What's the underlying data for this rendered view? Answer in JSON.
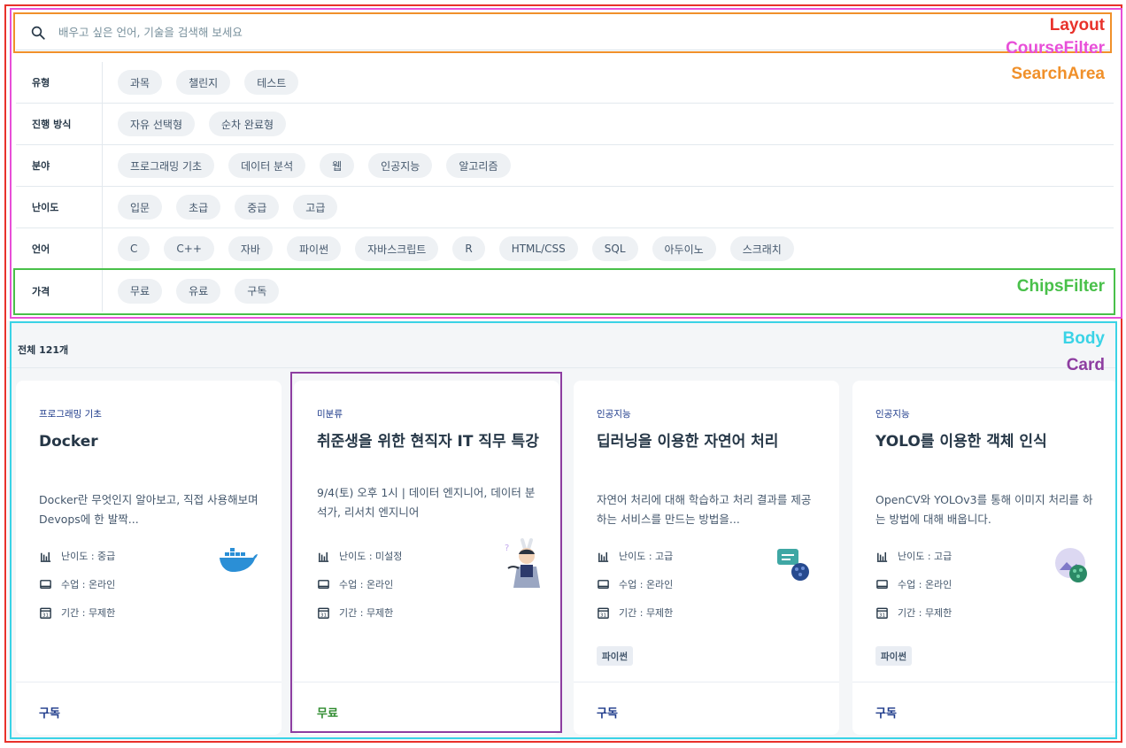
{
  "search": {
    "placeholder": "배우고 싶은 언어, 기술을 검색해 보세요"
  },
  "filters": [
    {
      "label": "유형",
      "chips": [
        "과목",
        "챌린지",
        "테스트"
      ]
    },
    {
      "label": "진행 방식",
      "chips": [
        "자유 선택형",
        "순차 완료형"
      ]
    },
    {
      "label": "분야",
      "chips": [
        "프로그래밍 기초",
        "데이터 분석",
        "웹",
        "인공지능",
        "알고리즘"
      ]
    },
    {
      "label": "난이도",
      "chips": [
        "입문",
        "초급",
        "중급",
        "고급"
      ]
    },
    {
      "label": "언어",
      "chips": [
        "C",
        "C++",
        "자바",
        "파이썬",
        "자바스크립트",
        "R",
        "HTML/CSS",
        "SQL",
        "아두이노",
        "스크래치"
      ]
    },
    {
      "label": "가격",
      "chips": [
        "무료",
        "유료",
        "구독"
      ]
    }
  ],
  "body": {
    "total": "전체 121개"
  },
  "cards": [
    {
      "category": "프로그래밍 기초",
      "title": "Docker",
      "desc": "Docker란 무엇인지 알아보고, 직접 사용해보며 Devops에 한 발짝...",
      "difficulty": "난이도 : 중급",
      "mode": "수업 : 온라인",
      "period": "기간 : 무제한",
      "tag": "",
      "price": "구독",
      "price_color": "#1d3a8a",
      "icon": "docker-whale-icon"
    },
    {
      "category": "미분류",
      "title": "취준생을 위한 현직자 IT 직무 특강",
      "desc": "9/4(토) 오후 1시 | 데이터 엔지니어, 데이터 분석가, 리서치 엔지니어",
      "difficulty": "난이도 : 미설정",
      "mode": "수업 : 온라인",
      "period": "기간 : 무제한",
      "tag": "",
      "price": "무료",
      "price_color": "#2e8b2e",
      "icon": "rabbit-character-icon"
    },
    {
      "category": "인공지능",
      "title": "딥러닝을 이용한 자연어 처리",
      "desc": "자연어 처리에 대해 학습하고 처리 결과를 제공하는 서비스를 만드는 방법을...",
      "difficulty": "난이도 : 고급",
      "mode": "수업 : 온라인",
      "period": "기간 : 무제한",
      "tag": "파이썬",
      "price": "구독",
      "price_color": "#1d3a8a",
      "icon": "chat-brain-icon"
    },
    {
      "category": "인공지능",
      "title": "YOLO를 이용한 객체 인식",
      "desc": "OpenCV와 YOLOv3를 통해 이미지 처리를 하는 방법에 대해 배웁니다.",
      "difficulty": "난이도 : 고급",
      "mode": "수업 : 온라인",
      "period": "기간 : 무제한",
      "tag": "파이썬",
      "price": "구독",
      "price_color": "#1d3a8a",
      "icon": "image-brain-icon"
    }
  ],
  "annotations": {
    "layout": "Layout",
    "course_filter": "CourseFilter",
    "search_area": "SearchArea",
    "chips_filter": "ChipsFilter",
    "body": "Body",
    "card": "Card"
  },
  "annotation_colors": {
    "layout": "#e8322b",
    "course_filter": "#e84fd8",
    "search_area": "#f0902a",
    "chips_filter": "#49c04a",
    "body": "#3ad3e6",
    "card": "#8e3ea1"
  }
}
